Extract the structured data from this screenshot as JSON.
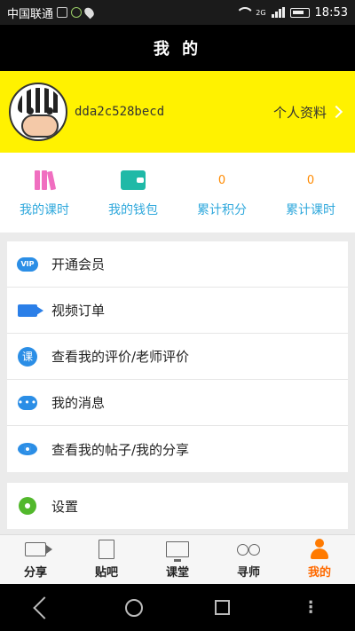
{
  "status_bar": {
    "carrier": "中国联通",
    "network": "2G",
    "time": "18:53"
  },
  "header": {
    "title": "我 的"
  },
  "profile": {
    "username": "dda2c528becd",
    "profile_link_label": "个人资料"
  },
  "stats": [
    {
      "icon": "books-icon",
      "value": "",
      "label": "我的课时"
    },
    {
      "icon": "wallet-icon",
      "value": "",
      "label": "我的钱包"
    },
    {
      "icon": "",
      "value": "0",
      "label": "累计积分"
    },
    {
      "icon": "",
      "value": "0",
      "label": "累计课时"
    }
  ],
  "menu": [
    {
      "icon": "vip-icon",
      "label": "开通会员"
    },
    {
      "icon": "video-camera-icon",
      "label": "视频订单"
    },
    {
      "icon": "course-icon",
      "icon_text": "课",
      "label": "查看我的评价/老师评价"
    },
    {
      "icon": "message-icon",
      "icon_text": "•••",
      "label": "我的消息"
    },
    {
      "icon": "eye-icon",
      "label": "查看我的帖子/我的分享"
    }
  ],
  "menu2": [
    {
      "icon": "gear-icon",
      "label": "设置"
    }
  ],
  "vip_icon_text": "VIP",
  "tabbar": [
    {
      "icon": "share-icon",
      "label": "分享"
    },
    {
      "icon": "post-icon",
      "label": "贴吧"
    },
    {
      "icon": "classroom-icon",
      "label": "课堂"
    },
    {
      "icon": "find-teacher-icon",
      "label": "寻师"
    },
    {
      "icon": "user-icon",
      "label": "我的",
      "active": true
    }
  ],
  "colors": {
    "header_bg": "#000000",
    "profile_bg": "#fff200",
    "accent_blue": "#2fa8dc",
    "active_tab": "#ff6a00",
    "stat_value": "#ff8a00"
  }
}
